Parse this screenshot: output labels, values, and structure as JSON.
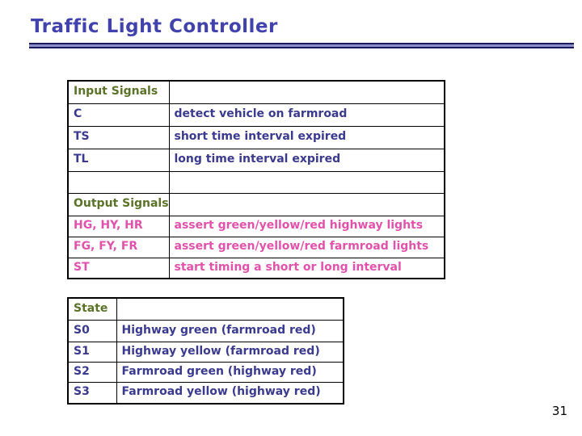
{
  "slide": {
    "title": "Traffic Light Controller",
    "page_number": "31"
  },
  "colors": {
    "title": "#4242ad",
    "rule_edge": "#1a1a5e",
    "rule_fill": "#8e8ec8",
    "section_header": "#5b7328",
    "input_text": "#3a3a8f",
    "output_text": "#e052ac",
    "border": "#000000",
    "page_number": "#000000"
  },
  "signals_table": {
    "rows": [
      {
        "name": "Input Signals",
        "desc": "",
        "style": "section"
      },
      {
        "name": "C",
        "desc": "detect vehicle on farmroad",
        "style": "input"
      },
      {
        "name": "TS",
        "desc": "short time interval expired",
        "style": "input"
      },
      {
        "name": "TL",
        "desc": "long time interval expired",
        "style": "input"
      },
      {
        "name": "",
        "desc": "",
        "style": "empty"
      },
      {
        "name": "Output Signals",
        "desc": "",
        "style": "section"
      },
      {
        "name": "HG, HY, HR",
        "desc": "assert green/yellow/red highway lights",
        "style": "output"
      },
      {
        "name": "FG, FY, FR",
        "desc": "assert green/yellow/red farmroad lights",
        "style": "output"
      },
      {
        "name": "ST",
        "desc": "start timing a short or long interval",
        "style": "output"
      }
    ]
  },
  "state_table": {
    "rows": [
      {
        "state": "State",
        "meaning": "",
        "style": "section"
      },
      {
        "state": "S0",
        "meaning": "Highway green (farmroad red)",
        "style": "input"
      },
      {
        "state": "S1",
        "meaning": "Highway yellow (farmroad red)",
        "style": "input"
      },
      {
        "state": "S2",
        "meaning": "Farmroad green (highway red)",
        "style": "input"
      },
      {
        "state": "S3",
        "meaning": "Farmroad yellow (highway red)",
        "style": "input"
      }
    ]
  }
}
